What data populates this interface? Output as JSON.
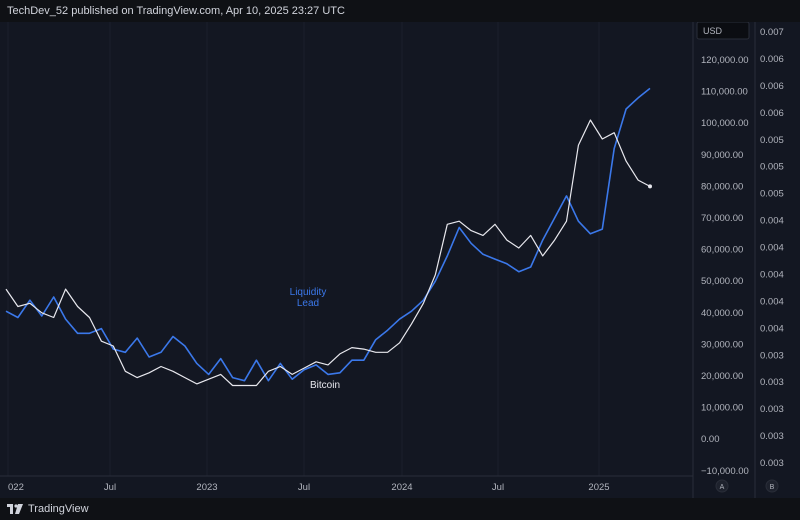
{
  "header": {
    "publisher_text": "TechDev_52 published on TradingView.com, Apr 10, 2025 23:27 UTC"
  },
  "footer": {
    "brand": "TradingView"
  },
  "currency_badge": "USD",
  "scale_buttons": {
    "auto": "A",
    "log": "B"
  },
  "colors": {
    "background": "#131722",
    "liquidity": "#3b78ea",
    "bitcoin": "#e8e8ee",
    "grid": "#1b1f2c"
  },
  "chart_data": {
    "type": "line",
    "x_tick_labels": [
      "022",
      "Jul",
      "2023",
      "Jul",
      "2024",
      "Jul",
      "2025"
    ],
    "right_axis_labels": [
      "120,000.00",
      "110,000.00",
      "100,000.00",
      "90,000.00",
      "80,000.00",
      "70,000.00",
      "60,000.00",
      "50,000.00",
      "40,000.00",
      "30,000.00",
      "20,000.00",
      "10,000.00",
      "0.00",
      "−10,000.00"
    ],
    "far_right_axis_labels": [
      "0.007",
      "0.006",
      "0.006",
      "0.006",
      "0.005",
      "0.005",
      "0.005",
      "0.004",
      "0.004",
      "0.004",
      "0.004",
      "0.004",
      "0.003",
      "0.003",
      "0.003",
      "0.003",
      "0.003"
    ],
    "ylim": [
      -10000,
      125000
    ],
    "grid": false,
    "series": [
      {
        "name": "Liquidity Lead",
        "label_lines": [
          "Liquidity",
          "Lead"
        ],
        "color": "#3b78ea",
        "x": [
          0,
          0.7,
          1.4,
          2.1,
          2.8,
          3.5,
          4.2,
          4.9,
          5.6,
          6.3,
          7,
          7.7,
          8.4,
          9.1,
          9.8,
          10.5,
          11.2,
          11.9,
          12.6,
          13.3,
          14,
          14.7,
          15.4,
          16.1,
          16.8,
          17.5,
          18.2,
          18.9,
          19.6,
          20.3,
          21,
          21.7,
          22.4,
          23.1,
          23.8,
          24.5,
          25.2,
          25.9,
          26.6,
          27.3,
          28,
          28.7,
          29.4,
          30.1,
          30.8,
          31.5,
          32.2,
          32.9,
          33.6,
          34.3,
          35,
          35.7,
          36.4,
          37.1,
          37.8
        ],
        "values": [
          40500,
          38500,
          44000,
          39000,
          45000,
          38000,
          33500,
          33500,
          35000,
          28500,
          27500,
          32000,
          26000,
          27500,
          32500,
          29500,
          24000,
          20500,
          25500,
          19500,
          18500,
          25000,
          18500,
          24000,
          19000,
          22000,
          23500,
          20500,
          21000,
          25000,
          25000,
          31500,
          34500,
          38000,
          40500,
          44000,
          50000,
          58000,
          67000,
          62000,
          58500,
          57000,
          55500,
          53000,
          54500,
          63000,
          70000,
          77000,
          69000,
          65000,
          66500,
          92000,
          104500,
          108000,
          111000
        ]
      },
      {
        "name": "Bitcoin",
        "label_lines": [
          "Bitcoin"
        ],
        "color": "#e8e8ee",
        "x": [
          0,
          0.7,
          1.4,
          2.1,
          2.8,
          3.5,
          4.2,
          4.9,
          5.6,
          6.3,
          7,
          7.7,
          8.4,
          9.1,
          9.8,
          10.5,
          11.2,
          11.9,
          12.6,
          13.3,
          14,
          14.7,
          15.4,
          16.1,
          16.8,
          17.5,
          18.2,
          18.9,
          19.6,
          20.3,
          21,
          21.7,
          22.4,
          23.1,
          23.8,
          24.5,
          25.2,
          25.9,
          26.6,
          27.3,
          28,
          28.7,
          29.4,
          30.1,
          30.8,
          31.5,
          32.2,
          32.9,
          33.6,
          34.3,
          35,
          35.7,
          36.4,
          37.1,
          37.8
        ],
        "values": [
          47500,
          42000,
          43000,
          40000,
          38500,
          47500,
          42000,
          38500,
          31000,
          29500,
          21500,
          19500,
          21000,
          23000,
          21500,
          19500,
          17500,
          19000,
          20500,
          17000,
          17000,
          17000,
          21500,
          23000,
          20500,
          22500,
          24500,
          23500,
          27000,
          29000,
          28500,
          27500,
          27500,
          30500,
          36500,
          43000,
          52000,
          68000,
          69000,
          66000,
          64500,
          68000,
          63000,
          60500,
          64500,
          58000,
          63000,
          69000,
          93000,
          101000,
          95000,
          97000,
          88000,
          82000,
          80000
        ]
      }
    ]
  }
}
